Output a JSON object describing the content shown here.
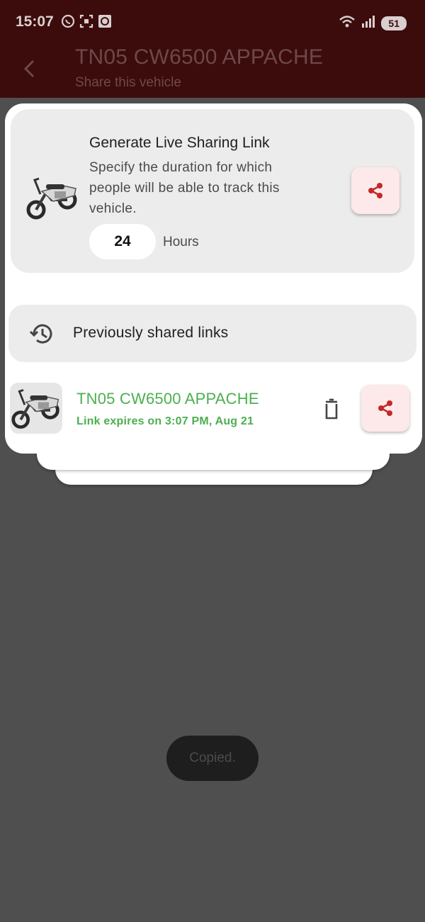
{
  "status_bar": {
    "time": "15:07",
    "battery": "51",
    "left_icons": [
      "whatsapp-icon",
      "screenshot-icon",
      "app-notification-icon"
    ],
    "right_icons": [
      "wifi-icon",
      "signal-icon",
      "battery-icon"
    ]
  },
  "app_bar": {
    "title": "TN05 CW6500 APPACHE",
    "subtitle": "Share this vehicle",
    "back_icon": "chevron-left-icon"
  },
  "generate_card": {
    "title": "Generate Live Sharing Link",
    "description": "Specify the duration for which people will be able to track this vehicle.",
    "duration_value": "24",
    "duration_unit": "Hours",
    "share_icon": "share-icon"
  },
  "previous_links": {
    "header": "Previously shared links",
    "header_icon": "history-icon",
    "items": [
      {
        "name": "TN05 CW6500 APPACHE",
        "expiry": "Link expires on 3:07 PM, Aug 21"
      }
    ]
  },
  "toast": {
    "text": "Copied."
  },
  "colors": {
    "app_bar": "#3c0c0c",
    "accent_red": "#c62828",
    "share_button_bg": "#fde9e9",
    "link_green": "#4caf50",
    "scrim": "#4f4f4f"
  }
}
